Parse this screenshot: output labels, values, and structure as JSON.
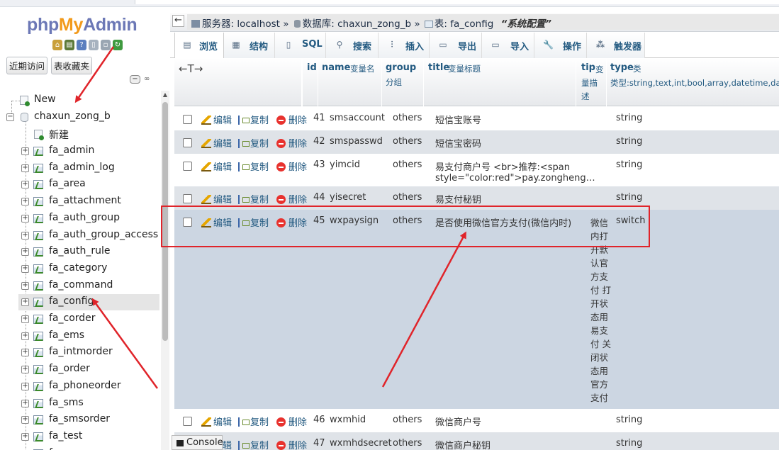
{
  "logo": {
    "php": "php",
    "my": "My",
    "admin": "Admin"
  },
  "nav_tabs": [
    "近期访问",
    "表收藏夹"
  ],
  "tree": {
    "new": "New",
    "database": "chaxun_zong_b",
    "db_new": "新建",
    "tables": [
      "fa_admin",
      "fa_admin_log",
      "fa_area",
      "fa_attachment",
      "fa_auth_group",
      "fa_auth_group_access",
      "fa_auth_rule",
      "fa_category",
      "fa_command",
      "fa_config",
      "fa_corder",
      "fa_ems",
      "fa_intmorder",
      "fa_order",
      "fa_phoneorder",
      "fa_sms",
      "fa_smsorder",
      "fa_test",
      "fa_u"
    ],
    "selected": "fa_config"
  },
  "breadcrumb": {
    "server": "服务器: localhost",
    "database": "数据库: chaxun_zong_b",
    "table": "表: fa_config",
    "comment": "“系统配置”"
  },
  "tabs": [
    "浏览",
    "结构",
    "SQL",
    "搜索",
    "插入",
    "导出",
    "导入",
    "操作",
    "触发器"
  ],
  "columns": {
    "arrows": "←T→",
    "id": "id",
    "name": "name",
    "name_sub": "变量名",
    "group": "group",
    "group_sub": "分组",
    "title": "title",
    "title_sub": "变量标题",
    "tip": "tip",
    "tip_sub": "变量描述",
    "type": "type",
    "type_sub": "类型:string,text,int,bool,array,datetime,date,f"
  },
  "actions": {
    "edit": "编辑",
    "copy": "复制",
    "delete": "删除"
  },
  "rows": [
    {
      "id": "41",
      "name": "smsaccount",
      "group": "others",
      "title": "短信宝账号",
      "tip": "",
      "type": "string"
    },
    {
      "id": "42",
      "name": "smspasswd",
      "group": "others",
      "title": "短信宝密码",
      "tip": "",
      "type": "string"
    },
    {
      "id": "43",
      "name": "yimcid",
      "group": "others",
      "title": "易支付商户号 <br>推荐:<span",
      "title2": "style=\"color:red\">pay.zongheng…",
      "tip": "",
      "type": "string"
    },
    {
      "id": "44",
      "name": "yisecret",
      "group": "others",
      "title": "易支付秘钥",
      "tip": "",
      "type": "string"
    },
    {
      "id": "45",
      "name": "wxpaysign",
      "group": "others",
      "title": "是否使用微信官方支付(微信内时)",
      "tip": "微信内打开默认官方支付 打开状态用易支付 关闭状态用官方支付",
      "type": "switch"
    },
    {
      "id": "46",
      "name": "wxmhid",
      "group": "others",
      "title": "微信商户号",
      "tip": "",
      "type": "string"
    },
    {
      "id": "47",
      "name": "wxmhdsecret",
      "group": "others",
      "title": "微信商户秘钥",
      "tip": "",
      "type": "string"
    }
  ],
  "console": "Console",
  "colors": {
    "link": "#235a81",
    "annotation": "#e0242a",
    "logo_php": "#6c78b6",
    "logo_my": "#f29a1b"
  }
}
